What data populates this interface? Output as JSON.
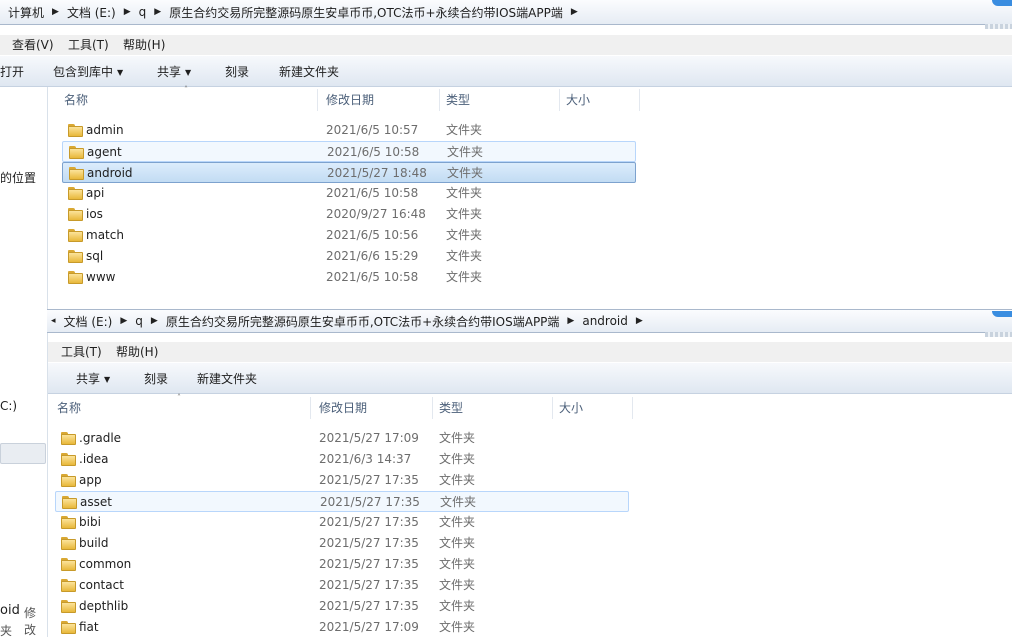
{
  "top": {
    "breadcrumb": [
      "计算机",
      "文档 (E:)",
      "q",
      "原生合约交易所完整源码原生安卓币币,OTC法币+永续合约带IOS端APP端"
    ],
    "menu": [
      "查看(V)",
      "工具(T)",
      "帮助(H)"
    ],
    "toolbar": {
      "open": "打开",
      "include": "包含到库中",
      "share": "共享",
      "burn": "刻录",
      "new_folder": "新建文件夹"
    },
    "columns": {
      "name": "名称",
      "date": "修改日期",
      "type": "类型",
      "size": "大小"
    },
    "files": [
      {
        "name": "admin",
        "date": "2021/6/5 10:57",
        "type": "文件夹"
      },
      {
        "name": "agent",
        "date": "2021/6/5 10:58",
        "type": "文件夹"
      },
      {
        "name": "android",
        "date": "2021/5/27 18:48",
        "type": "文件夹"
      },
      {
        "name": "api",
        "date": "2021/6/5 10:58",
        "type": "文件夹"
      },
      {
        "name": "ios",
        "date": "2020/9/27 16:48",
        "type": "文件夹"
      },
      {
        "name": "match",
        "date": "2021/6/5 10:56",
        "type": "文件夹"
      },
      {
        "name": "sql",
        "date": "2021/6/6 15:29",
        "type": "文件夹"
      },
      {
        "name": "www",
        "date": "2021/6/5 10:58",
        "type": "文件夹"
      }
    ]
  },
  "nav": {
    "location_fragment": "的位置",
    "drive_fragment": "C:)",
    "status_name": "oid",
    "status_mod": "修改",
    "status_file": "夹"
  },
  "bottom": {
    "breadcrumb": [
      "文档 (E:)",
      "q",
      "原生合约交易所完整源码原生安卓币币,OTC法币+永续合约带IOS端APP端",
      "android"
    ],
    "menu": [
      "工具(T)",
      "帮助(H)"
    ],
    "toolbar": {
      "share": "共享",
      "burn": "刻录",
      "new_folder": "新建文件夹"
    },
    "columns": {
      "name": "名称",
      "date": "修改日期",
      "type": "类型",
      "size": "大小"
    },
    "files": [
      {
        "name": ".gradle",
        "date": "2021/5/27 17:09",
        "type": "文件夹"
      },
      {
        "name": ".idea",
        "date": "2021/6/3 14:37",
        "type": "文件夹"
      },
      {
        "name": "app",
        "date": "2021/5/27 17:35",
        "type": "文件夹"
      },
      {
        "name": "asset",
        "date": "2021/5/27 17:35",
        "type": "文件夹"
      },
      {
        "name": "bibi",
        "date": "2021/5/27 17:35",
        "type": "文件夹"
      },
      {
        "name": "build",
        "date": "2021/5/27 17:35",
        "type": "文件夹"
      },
      {
        "name": "common",
        "date": "2021/5/27 17:35",
        "type": "文件夹"
      },
      {
        "name": "contact",
        "date": "2021/5/27 17:35",
        "type": "文件夹"
      },
      {
        "name": "depthlib",
        "date": "2021/5/27 17:35",
        "type": "文件夹"
      },
      {
        "name": "fiat",
        "date": "2021/5/27 17:09",
        "type": "文件夹"
      }
    ]
  }
}
